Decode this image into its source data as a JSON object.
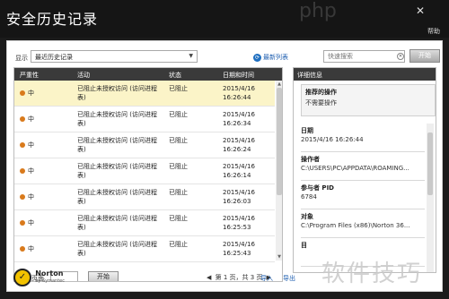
{
  "window": {
    "title": "安全历史记录",
    "close_icon": "close-icon",
    "help": "帮助"
  },
  "toolbar": {
    "show_label": "显示",
    "filter_value": "最近历史记录",
    "refresh_label": "最新列表",
    "search_placeholder": "快速搜索",
    "go_label": "开始"
  },
  "table": {
    "columns": [
      "严重性",
      "活动",
      "状态",
      "日期和时间"
    ],
    "rows": [
      {
        "severity": "中",
        "activity": "已阻止未授权访问 (访问进程表)",
        "status": "已阻止",
        "date": "2015/4/16",
        "time": "16:26:44",
        "selected": true
      },
      {
        "severity": "中",
        "activity": "已阻止未授权访问 (访问进程表)",
        "status": "已阻止",
        "date": "2015/4/16",
        "time": "16:26:34",
        "selected": false
      },
      {
        "severity": "中",
        "activity": "已阻止未授权访问 (访问进程表)",
        "status": "已阻止",
        "date": "2015/4/16",
        "time": "16:26:24",
        "selected": false
      },
      {
        "severity": "中",
        "activity": "已阻止未授权访问 (访问进程表)",
        "status": "已阻止",
        "date": "2015/4/16",
        "time": "16:26:14",
        "selected": false
      },
      {
        "severity": "中",
        "activity": "已阻止未授权访问 (访问进程表)",
        "status": "已阻止",
        "date": "2015/4/16",
        "time": "16:26:03",
        "selected": false
      },
      {
        "severity": "中",
        "activity": "已阻止未授权访问 (访问进程表)",
        "status": "已阻止",
        "date": "2015/4/16",
        "time": "16:25:53",
        "selected": false
      },
      {
        "severity": "中",
        "activity": "已阻止未授权访问 (访问进程表)",
        "status": "已阻止",
        "date": "2015/4/16",
        "time": "16:25:43",
        "selected": false
      }
    ],
    "goto_label": "转到页面",
    "jump_label": "开始",
    "pager_text": "第 1 页，共 3 页"
  },
  "details": {
    "header": "详细信息",
    "recommend_title": "推荐的操作",
    "recommend_value": "不需要操作",
    "items": [
      {
        "label": "日期",
        "value": "2015/4/16 16:26:44"
      },
      {
        "label": "操作者",
        "value": "C:\\USERS\\PC\\APPDATA\\ROAMING..."
      },
      {
        "label": "参与者 PID",
        "value": "6784"
      },
      {
        "label": "对象",
        "value": "C:\\Program Files (x86)\\Norton 36..."
      },
      {
        "label": "目",
        "value": ""
      }
    ]
  },
  "footer": {
    "brand_line1": "Norton",
    "brand_line2": "by Symantec",
    "import_label": "导入",
    "export_label": "导出"
  },
  "watermark": {
    "text": "软件技巧",
    "side_text": "php"
  },
  "colors": {
    "severity_medium": "#d97a1c",
    "selected_row": "#fbf4c8",
    "link": "#1f5fb0"
  }
}
